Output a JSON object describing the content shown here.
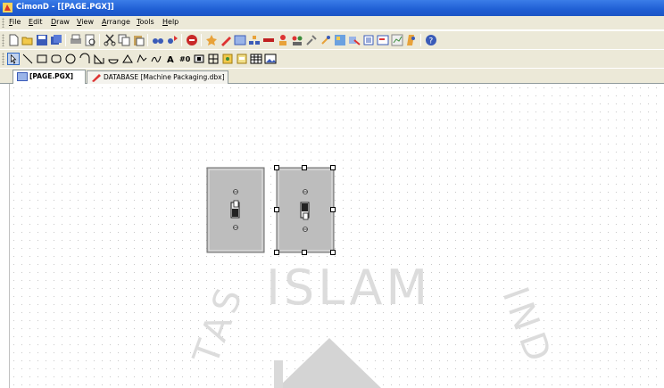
{
  "window": {
    "title": "CimonD - [[PAGE.PGX]]"
  },
  "menu": [
    {
      "pre": "",
      "u": "F",
      "post": "ile"
    },
    {
      "pre": "",
      "u": "E",
      "post": "dit"
    },
    {
      "pre": "",
      "u": "D",
      "post": "raw"
    },
    {
      "pre": "",
      "u": "V",
      "post": "iew"
    },
    {
      "pre": "",
      "u": "A",
      "post": "rrange"
    },
    {
      "pre": "",
      "u": "T",
      "post": "ools"
    },
    {
      "pre": "",
      "u": "H",
      "post": "elp"
    }
  ],
  "tabs": [
    {
      "label": "[PAGE.PGX]",
      "active": true
    },
    {
      "label": "DATABASE [Machine Packaging.dbx]",
      "active": false
    }
  ],
  "watermark": {
    "text": "ISLAM",
    "side_left": "TAS",
    "side_right": "IND",
    "color": "#d9d9d9"
  },
  "colors": {
    "titlebar": "#245edb",
    "chrome": "#ece9d8",
    "switch_plate": "#b8b8b8"
  }
}
